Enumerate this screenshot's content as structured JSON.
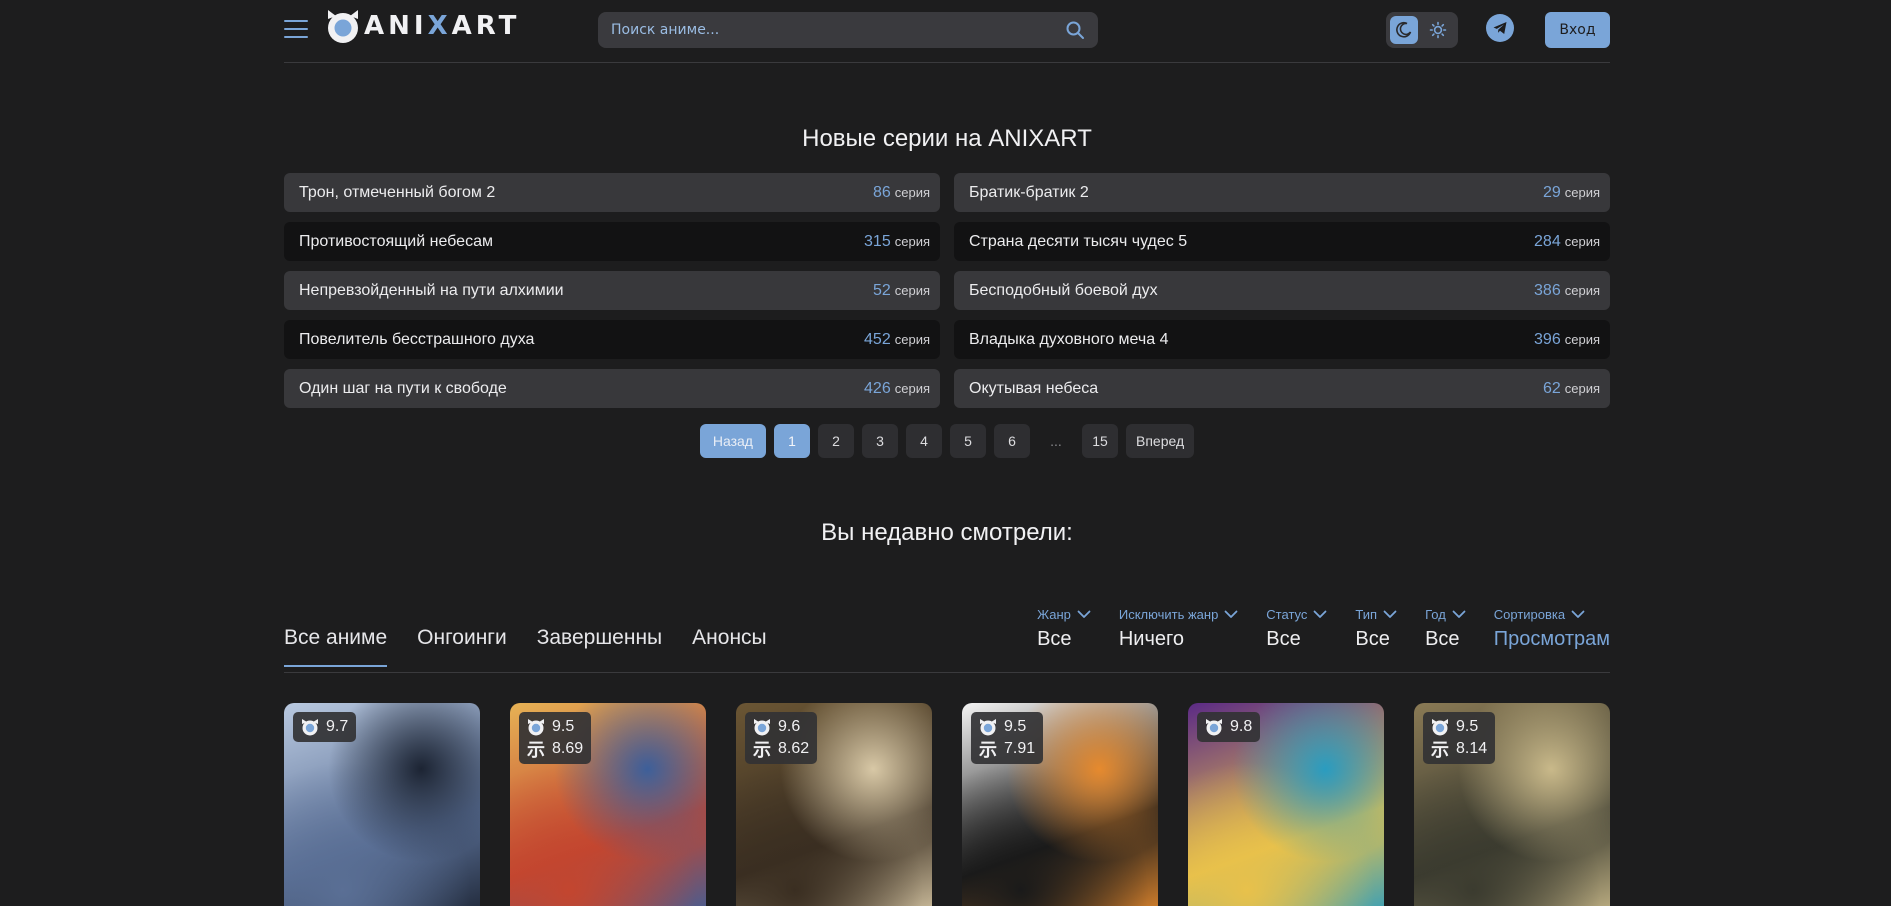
{
  "header": {
    "logo_prefix": "ANI",
    "logo_x": "X",
    "logo_suffix": "ART",
    "search_placeholder": "Поиск аниме...",
    "login_label": "Вход"
  },
  "colors": {
    "accent": "#7aa5d8",
    "background": "#1d1d1e"
  },
  "new_series": {
    "title": "Новые серии на ANIXART",
    "episode_label": "серия",
    "items": [
      {
        "name": "Трон, отмеченный богом 2",
        "episode": "86"
      },
      {
        "name": "Братик-братик 2",
        "episode": "29"
      },
      {
        "name": "Противостоящий небесам",
        "episode": "315"
      },
      {
        "name": "Страна десяти тысяч чудес 5",
        "episode": "284"
      },
      {
        "name": "Непревзойденный на пути алхимии",
        "episode": "52"
      },
      {
        "name": "Бесподобный боевой дух",
        "episode": "386"
      },
      {
        "name": "Повелитель бесстрашного духа",
        "episode": "452"
      },
      {
        "name": "Владыка духовного меча 4",
        "episode": "396"
      },
      {
        "name": "Один шаг на пути к свободе",
        "episode": "426"
      },
      {
        "name": "Окутывая небеса",
        "episode": "62"
      }
    ]
  },
  "pagination": {
    "back": "Назад",
    "pages": [
      "1",
      "2",
      "3",
      "4",
      "5",
      "6"
    ],
    "ellipsis": "...",
    "last": "15",
    "next": "Вперед",
    "current": "1"
  },
  "recent": {
    "title": "Вы недавно смотрели:"
  },
  "tabs": [
    "Все аниме",
    "Онгоинги",
    "Завершенны",
    "Анонсы"
  ],
  "active_tab": "Все аниме",
  "filters": [
    {
      "label": "Жанр",
      "value": "Все"
    },
    {
      "label": "Исключить жанр",
      "value": "Ничего"
    },
    {
      "label": "Статус",
      "value": "Все"
    },
    {
      "label": "Тип",
      "value": "Все"
    },
    {
      "label": "Год",
      "value": "Все"
    },
    {
      "label": "Сортировка",
      "value": "Просмотрам"
    }
  ],
  "cards": [
    {
      "anixart_rating": "9.7",
      "shiki_rating": null,
      "palette": [
        "#b9c9e0",
        "#5a6f95",
        "#1c2433"
      ]
    },
    {
      "anixart_rating": "9.5",
      "shiki_rating": "8.69",
      "palette": [
        "#e6b255",
        "#c3462f",
        "#3d5f9a"
      ]
    },
    {
      "anixart_rating": "9.6",
      "shiki_rating": "8.62",
      "palette": [
        "#6b5634",
        "#3a2e21",
        "#d8c8a6"
      ]
    },
    {
      "anixart_rating": "9.5",
      "shiki_rating": "7.91",
      "palette": [
        "#f4f4f4",
        "#1a1a1a",
        "#e68a2e"
      ]
    },
    {
      "anixart_rating": "9.8",
      "shiki_rating": null,
      "palette": [
        "#5b2a86",
        "#e8c14b",
        "#2a9cc0"
      ]
    },
    {
      "anixart_rating": "9.5",
      "shiki_rating": "8.14",
      "palette": [
        "#8a7a55",
        "#3b3b2f",
        "#c9b98a"
      ]
    }
  ],
  "shiki_glyph": "示"
}
